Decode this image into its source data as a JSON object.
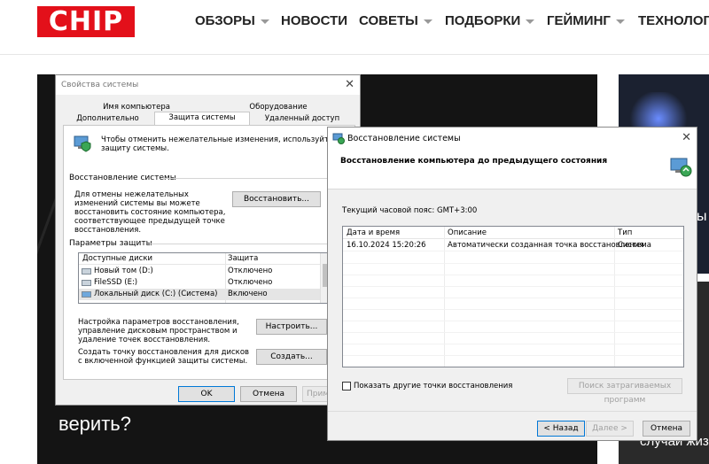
{
  "site": {
    "logo_text": "CHIP",
    "nav": [
      {
        "label": "ОБЗОРЫ",
        "has_dropdown": true
      },
      {
        "label": "НОВОСТИ",
        "has_dropdown": false
      },
      {
        "label": "СОВЕТЫ",
        "has_dropdown": true
      },
      {
        "label": "ПОДБОРКИ",
        "has_dropdown": true
      },
      {
        "label": "ГЕЙМИНГ",
        "has_dropdown": true
      },
      {
        "label": "ТЕХНОЛОГИ",
        "has_dropdown": false
      }
    ],
    "article_main_title_fragment": "верить?",
    "side_fragment": "ы",
    "side2_fragment": "случаи жиз"
  },
  "sysprops": {
    "title": "Свойства системы",
    "tabs_top": [
      "Имя компьютера",
      "Оборудование"
    ],
    "tabs_bottom": [
      "Дополнительно",
      "Защита системы",
      "Удаленный доступ"
    ],
    "intro_text": "Чтобы отменить нежелательные изменения, используйте защиту системы.",
    "restore_group": "Восстановление системы",
    "restore_text": "Для отмены нежелательных изменений системы вы можете восстановить состояние компьютера, соответствующее предыдущей точке восстановления.",
    "restore_button": "Восстановить...",
    "protection_group": "Параметры защиты",
    "list_headers": [
      "Доступные диски",
      "Защита"
    ],
    "drives": [
      {
        "name": "Новый том (D:)",
        "status": "Отключено"
      },
      {
        "name": "FileSSD (E:)",
        "status": "Отключено"
      },
      {
        "name": "Локальный диск (C:) (Система)",
        "status": "Включено"
      }
    ],
    "configure_text": "Настройка параметров восстановления, управление дисковым пространством и удаление точек восстановления.",
    "configure_button": "Настроить...",
    "create_text": "Создать точку восстановления для дисков с включенной функцией защиты системы.",
    "create_button": "Создать...",
    "ok": "OK",
    "cancel": "Отмена",
    "apply": "Применить"
  },
  "restore": {
    "title": "Восстановление системы",
    "heading": "Восстановление компьютера до предыдущего состояния",
    "timezone": "Текущий часовой пояс: GMT+3:00",
    "columns": [
      "Дата и время",
      "Описание",
      "Тип"
    ],
    "rows": [
      {
        "date": "16.10.2024 15:20:26",
        "description": "Автоматически созданная точка восстановления",
        "type": "Система"
      }
    ],
    "show_more_label": "Показать другие точки восстановления",
    "show_more_checked": false,
    "scan_button": "Поиск затрагиваемых программ",
    "back_button": "< Назад",
    "next_button": "Далее >",
    "cancel_button": "Отмена"
  },
  "colors": {
    "brand": "#e3101a",
    "accent": "#0078d7"
  }
}
